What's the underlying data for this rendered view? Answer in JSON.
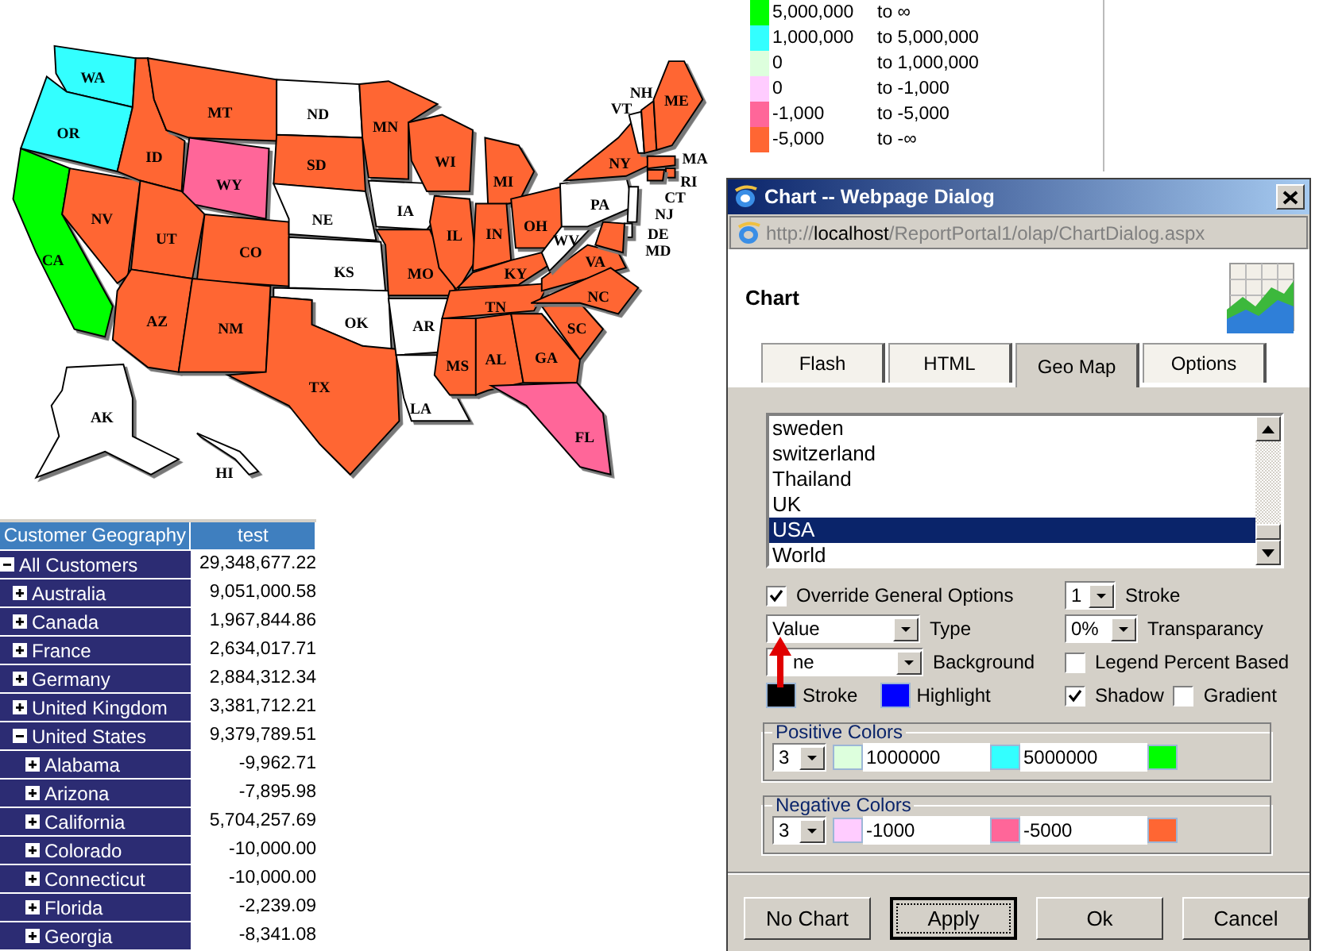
{
  "map": {
    "states": [
      {
        "abbr": "WA",
        "color": "#33ffff"
      },
      {
        "abbr": "OR",
        "color": "#33ffff"
      },
      {
        "abbr": "CA",
        "color": "#00ff00"
      },
      {
        "abbr": "NV",
        "color": "#ff6633"
      },
      {
        "abbr": "ID",
        "color": "#ff6633"
      },
      {
        "abbr": "MT",
        "color": "#ff6633"
      },
      {
        "abbr": "WY",
        "color": "#ff6699"
      },
      {
        "abbr": "UT",
        "color": "#ff6633"
      },
      {
        "abbr": "CO",
        "color": "#ff6633"
      },
      {
        "abbr": "AZ",
        "color": "#ff6633"
      },
      {
        "abbr": "NM",
        "color": "#ff6633"
      },
      {
        "abbr": "ND",
        "color": "#ffffff"
      },
      {
        "abbr": "SD",
        "color": "#ff6633"
      },
      {
        "abbr": "NE",
        "color": "#ffffff"
      },
      {
        "abbr": "KS",
        "color": "#ffffff"
      },
      {
        "abbr": "OK",
        "color": "#ffffff"
      },
      {
        "abbr": "TX",
        "color": "#ff6633"
      },
      {
        "abbr": "MN",
        "color": "#ff6633"
      },
      {
        "abbr": "IA",
        "color": "#ffffff"
      },
      {
        "abbr": "MO",
        "color": "#ff6633"
      },
      {
        "abbr": "AR",
        "color": "#ffffff"
      },
      {
        "abbr": "LA",
        "color": "#ffffff"
      },
      {
        "abbr": "WI",
        "color": "#ff6633"
      },
      {
        "abbr": "IL",
        "color": "#ff6633"
      },
      {
        "abbr": "MI",
        "color": "#ff6633"
      },
      {
        "abbr": "IN",
        "color": "#ff6633"
      },
      {
        "abbr": "OH",
        "color": "#ff6633"
      },
      {
        "abbr": "KY",
        "color": "#ff6633"
      },
      {
        "abbr": "TN",
        "color": "#ff6633"
      },
      {
        "abbr": "MS",
        "color": "#ff6633"
      },
      {
        "abbr": "AL",
        "color": "#ff6633"
      },
      {
        "abbr": "GA",
        "color": "#ff6633"
      },
      {
        "abbr": "FL",
        "color": "#ff6699"
      },
      {
        "abbr": "SC",
        "color": "#ff6633"
      },
      {
        "abbr": "VA",
        "color": "#ff6633"
      },
      {
        "abbr": "NC",
        "color": "#ff6633"
      },
      {
        "abbr": "WV",
        "color": "#ffffff"
      },
      {
        "abbr": "PA",
        "color": "#ffffff"
      },
      {
        "abbr": "NY",
        "color": "#ff6633"
      },
      {
        "abbr": "VT",
        "color": "#ffffff"
      },
      {
        "abbr": "NH",
        "color": "#ff6633"
      },
      {
        "abbr": "ME",
        "color": "#ff6633"
      },
      {
        "abbr": "MA",
        "color": "#ff6633"
      },
      {
        "abbr": "RI",
        "color": "#ff6633"
      },
      {
        "abbr": "CT",
        "color": "#ff6633"
      },
      {
        "abbr": "NJ",
        "color": "#ffffff"
      },
      {
        "abbr": "DE",
        "color": "#ffffff"
      },
      {
        "abbr": "MD",
        "color": "#ff6633"
      },
      {
        "abbr": "AK",
        "color": "#ffffff"
      },
      {
        "abbr": "HI",
        "color": "#ffffff"
      }
    ]
  },
  "legend": [
    {
      "color": "#00ff00",
      "from": "5,000,000",
      "to": "to ∞"
    },
    {
      "color": "#33ffff",
      "from": "1,000,000",
      "to": "to 5,000,000"
    },
    {
      "color": "#ddffdd",
      "from": "0",
      "to": "to 1,000,000"
    },
    {
      "color": "#ffccff",
      "from": "0",
      "to": "to -1,000"
    },
    {
      "color": "#ff6699",
      "from": "-1,000",
      "to": "to -5,000"
    },
    {
      "color": "#ff6633",
      "from": "-5,000",
      "to": "to -∞"
    }
  ],
  "table": {
    "columns": [
      "Customer Geography",
      "test"
    ],
    "rows": [
      {
        "label": "All Customers",
        "value": "29,348,677.22",
        "expanded": true,
        "children": [
          {
            "label": "Australia",
            "value": "9,051,000.58",
            "expanded": false
          },
          {
            "label": "Canada",
            "value": "1,967,844.86",
            "expanded": false
          },
          {
            "label": "France",
            "value": "2,634,017.71",
            "expanded": false
          },
          {
            "label": "Germany",
            "value": "2,884,312.34",
            "expanded": false
          },
          {
            "label": "United Kingdom",
            "value": "3,381,712.21",
            "expanded": false
          },
          {
            "label": "United States",
            "value": "9,379,789.51",
            "expanded": true,
            "children": [
              {
                "label": "Alabama",
                "value": "-9,962.71",
                "expanded": false
              },
              {
                "label": "Arizona",
                "value": "-7,895.98",
                "expanded": false
              },
              {
                "label": "California",
                "value": "5,704,257.69",
                "expanded": false
              },
              {
                "label": "Colorado",
                "value": "-10,000.00",
                "expanded": false
              },
              {
                "label": "Connecticut",
                "value": "-10,000.00",
                "expanded": false
              },
              {
                "label": "Florida",
                "value": "-2,239.09",
                "expanded": false
              },
              {
                "label": "Georgia",
                "value": "-8,341.08",
                "expanded": false
              }
            ]
          }
        ]
      }
    ]
  },
  "dialog": {
    "title": "Chart -- Webpage Dialog",
    "address": {
      "scheme": "http://",
      "host": "localhost",
      "path": "/ReportPortal1/olap/ChartDialog.aspx"
    },
    "heading": "Chart",
    "tabs": [
      {
        "label": "Flash",
        "selected": false
      },
      {
        "label": "HTML",
        "selected": false
      },
      {
        "label": "Geo Map",
        "selected": true
      },
      {
        "label": "Options",
        "selected": false
      }
    ],
    "countries": [
      {
        "label": "sweden",
        "selected": false
      },
      {
        "label": "switzerland",
        "selected": false
      },
      {
        "label": "Thailand",
        "selected": false
      },
      {
        "label": "UK",
        "selected": false
      },
      {
        "label": "USA",
        "selected": true
      },
      {
        "label": "World",
        "selected": false
      }
    ],
    "override": {
      "label": "Override General Options",
      "checked": true
    },
    "type": {
      "value": "Value",
      "label": "Type"
    },
    "background": {
      "value": "ne",
      "label": "Background"
    },
    "stroke_color": {
      "label": "Stroke",
      "color": "#000000"
    },
    "highlight_color": {
      "label": "Highlight",
      "color": "#0000ff"
    },
    "stroke_width": {
      "value": "1",
      "label": "Stroke"
    },
    "transparency": {
      "value": "0%",
      "label": "Transparancy"
    },
    "checks": [
      {
        "label": "Legend Percent Based",
        "checked": false
      },
      {
        "label": "Shadow",
        "checked": true
      },
      {
        "label": "Gradient",
        "checked": false
      }
    ],
    "groups": [
      {
        "title": "Positive Colors",
        "count": "3",
        "colors": [
          {
            "color": "#ddffdd"
          },
          {
            "color": "#33ffff"
          },
          {
            "color": "#00ff00"
          }
        ],
        "thresholds": [
          "1000000",
          "5000000"
        ]
      },
      {
        "title": "Negative Colors",
        "count": "3",
        "colors": [
          {
            "color": "#ffccff"
          },
          {
            "color": "#ff6699"
          },
          {
            "color": "#ff6633"
          }
        ],
        "thresholds": [
          "-1000",
          "-5000"
        ]
      }
    ],
    "buttons": [
      {
        "label": "No Chart",
        "focused": false
      },
      {
        "label": "Apply",
        "focused": true
      },
      {
        "label": "Ok",
        "focused": false
      },
      {
        "label": "Cancel",
        "focused": false
      }
    ]
  }
}
